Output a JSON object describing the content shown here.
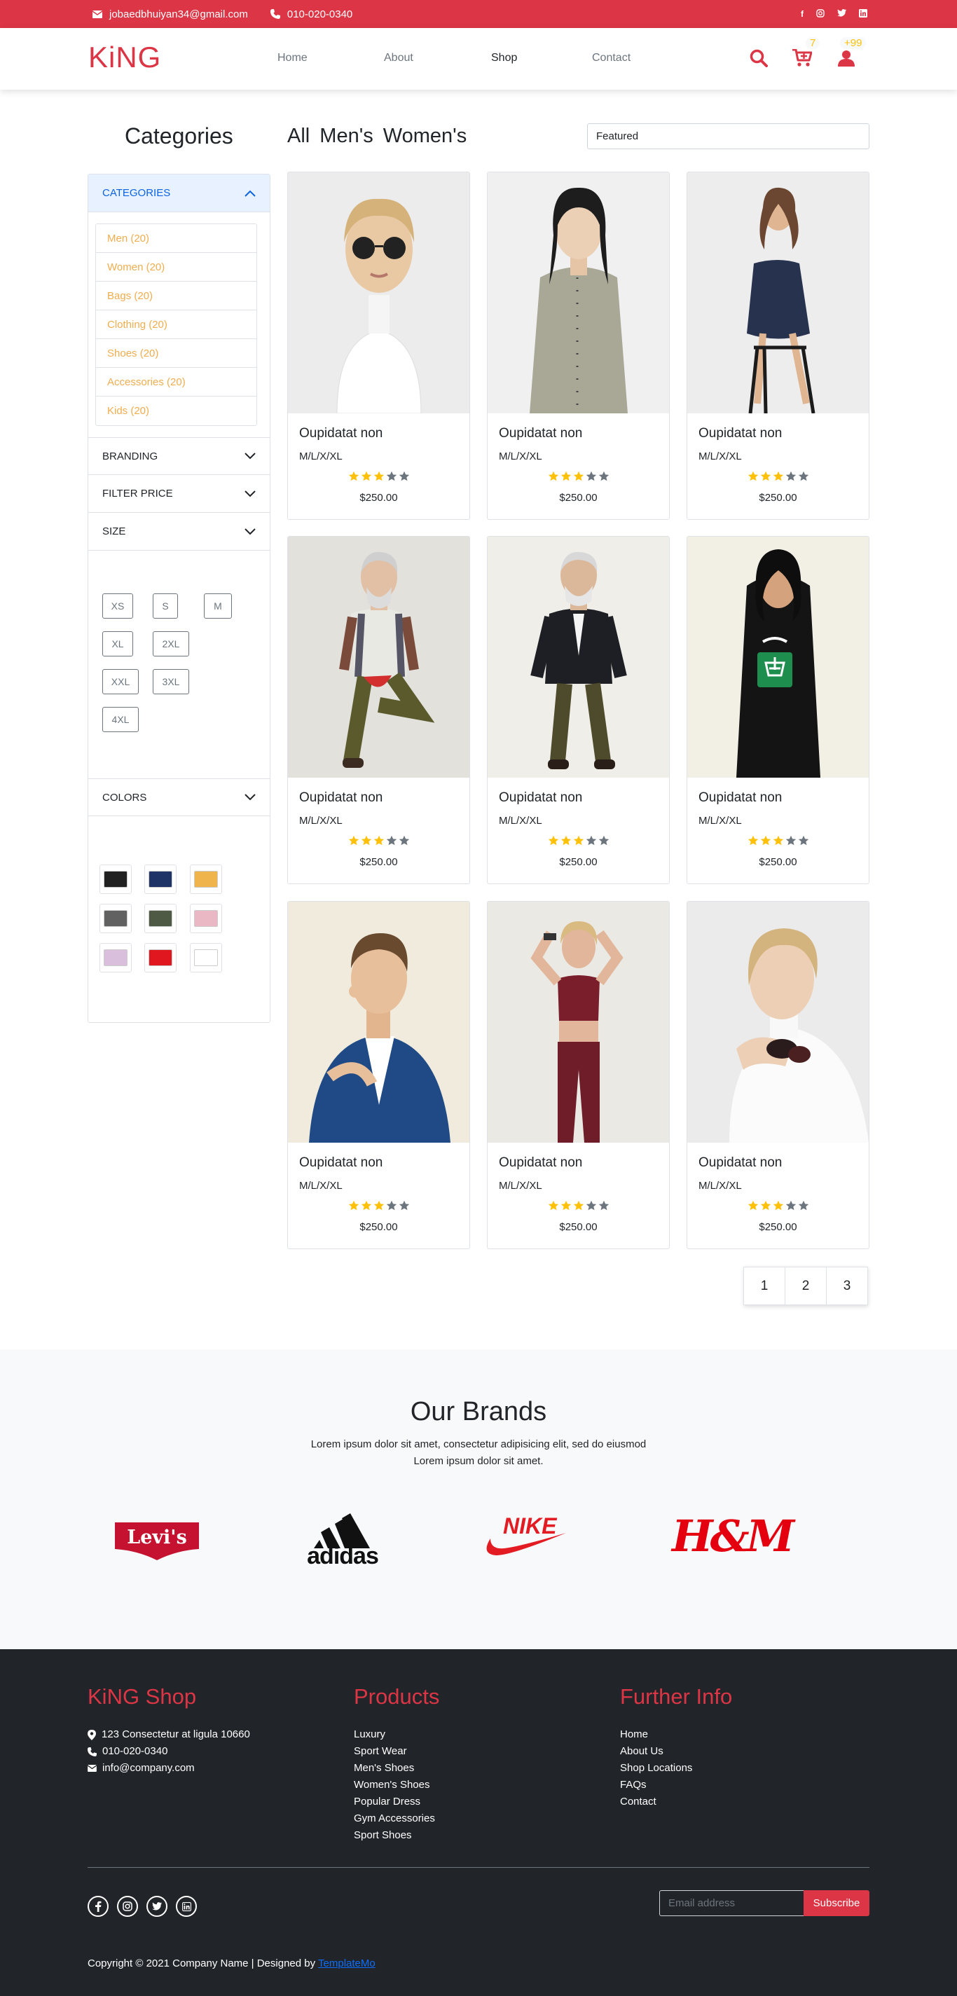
{
  "topbar": {
    "email": "jobaedbhuiyan34@gmail.com",
    "phone": "010-020-0340",
    "social": [
      "f",
      "ig",
      "tw",
      "in"
    ]
  },
  "nav": {
    "logo": "KiNG",
    "links": [
      "Home",
      "About",
      "Shop",
      "Contact"
    ],
    "active_link": "Shop",
    "cart_count": "7",
    "user_count": "+99",
    "icons": [
      "search-icon",
      "cart-icon",
      "user-icon"
    ]
  },
  "sidebar": {
    "title": "Categories",
    "categories_header": "CATEGORIES",
    "categories": [
      "Men (20)",
      "Women (20)",
      "Bags (20)",
      "Clothing (20)",
      "Shoes (20)",
      "Accessories (20)",
      "Kids (20)"
    ],
    "branding_header": "BRANDING",
    "price_header": "FILTER PRICE",
    "size_header": "SIZE",
    "sizes": [
      "XS",
      "S",
      "M",
      "XL",
      "2XL",
      "XXL",
      "3XL",
      "4XL"
    ],
    "colors_header": "COLORS",
    "colors": [
      "#212121",
      "#1f3466",
      "#f0b44c",
      "#616161",
      "#4e5a44",
      "#eab8c5",
      "#d9bfdc",
      "#e0171f",
      "#ffffff"
    ]
  },
  "main": {
    "heading": "All Men's Women's",
    "sort_selected": "Featured",
    "products": [
      {
        "name": "Oupidatat non",
        "sizes": "M/L/X/XL",
        "rating": 3,
        "price": "$250.00"
      },
      {
        "name": "Oupidatat non",
        "sizes": "M/L/X/XL",
        "rating": 3,
        "price": "$250.00"
      },
      {
        "name": "Oupidatat non",
        "sizes": "M/L/X/XL",
        "rating": 3,
        "price": "$250.00"
      },
      {
        "name": "Oupidatat non",
        "sizes": "M/L/X/XL",
        "rating": 3,
        "price": "$250.00"
      },
      {
        "name": "Oupidatat non",
        "sizes": "M/L/X/XL",
        "rating": 3,
        "price": "$250.00"
      },
      {
        "name": "Oupidatat non",
        "sizes": "M/L/X/XL",
        "rating": 3,
        "price": "$250.00"
      },
      {
        "name": "Oupidatat non",
        "sizes": "M/L/X/XL",
        "rating": 3,
        "price": "$250.00"
      },
      {
        "name": "Oupidatat non",
        "sizes": "M/L/X/XL",
        "rating": 3,
        "price": "$250.00"
      },
      {
        "name": "Oupidatat non",
        "sizes": "M/L/X/XL",
        "rating": 3,
        "price": "$250.00"
      }
    ],
    "pages": [
      "1",
      "2",
      "3"
    ]
  },
  "brands": {
    "title": "Our Brands",
    "text_line1": "Lorem ipsum dolor sit amet, consectetur adipisicing elit, sed do eiusmod",
    "text_line2": "Lorem ipsum dolor sit amet.",
    "logos": [
      "Levi's",
      "adidas",
      "NIKE",
      "H&M"
    ]
  },
  "footer": {
    "col1_title": "KiNG Shop",
    "address": "123 Consectetur at ligula 10660",
    "phone": "010-020-0340",
    "email": "info@company.com",
    "col2_title": "Products",
    "products": [
      "Luxury",
      "Sport Wear",
      "Men's Shoes",
      "Women's Shoes",
      "Popular Dress",
      "Gym Accessories",
      "Sport Shoes"
    ],
    "col3_title": "Further Info",
    "info": [
      "Home",
      "About Us",
      "Shop Locations",
      "FAQs",
      "Contact"
    ],
    "email_placeholder": "Email address",
    "subscribe_label": "Subscribe",
    "copyright": "Copyright © 2021 Company Name | Designed by",
    "designer": "TemplateMo"
  },
  "colors": {
    "brand_red": "#dc3545",
    "star_gold": "#ffc107",
    "star_grey": "#6c757d",
    "footer_bg": "#212529"
  }
}
